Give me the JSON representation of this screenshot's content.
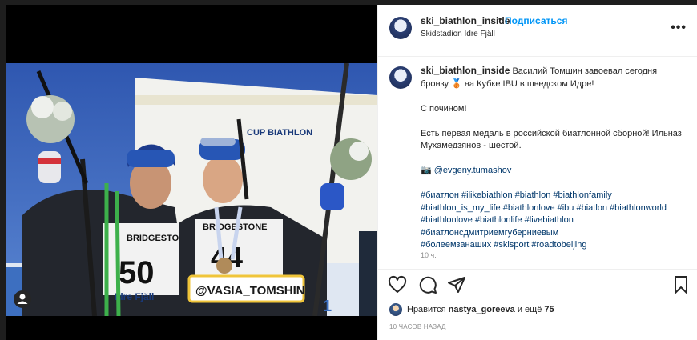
{
  "post": {
    "username": "ski_biathlon_inside",
    "dot": "•",
    "follow_label": "Подписаться",
    "location": "Skidstadion Idre Fjäll",
    "more_label": "•••"
  },
  "caption": {
    "username": "ski_biathlon_inside",
    "line1": "Василий Томшин завоевал сегодня бронзу 🥉 на Кубке IBU в шведском Идре!",
    "line2": "С почином!",
    "line3": "Есть первая медаль в российской биатлонной сборной! Ильназ Мухамедзянов - шестой.",
    "photo_credit": "📷 @evgeny.tumashov",
    "hashtags_1": "#биатлон #ilikebiathlon #biathlon #biathlonfamily",
    "hashtags_2": "#biathlon_is_my_life #biathlonlove #ibu #biatlon #biathlonworld",
    "hashtags_3": "#biathlonlove #biathlonlife #livebiathlon",
    "hashtags_4": "#биатлонсдмитриемгуберниевым",
    "hashtags_5": "#болеемзанаших #skisport #roadtobeijing",
    "time_ago": "10 ч."
  },
  "photo": {
    "bib_left": "50",
    "bib_right": "44",
    "sponsor": "BRIDGESTONE",
    "venue": "Idre Fjäll",
    "banner": "CUP BIATHLON",
    "overlay_tag": "@VASIA_TOMSHIN"
  },
  "likes": {
    "prefix": "Нравится ",
    "user": "nastya_goreeva",
    "middle": " и ещё ",
    "count": "75"
  },
  "timestamp": "10 ЧАСОВ НАЗАД",
  "colors": {
    "link": "#00376b",
    "follow": "#0095f6",
    "muted": "#8e8e8e"
  }
}
